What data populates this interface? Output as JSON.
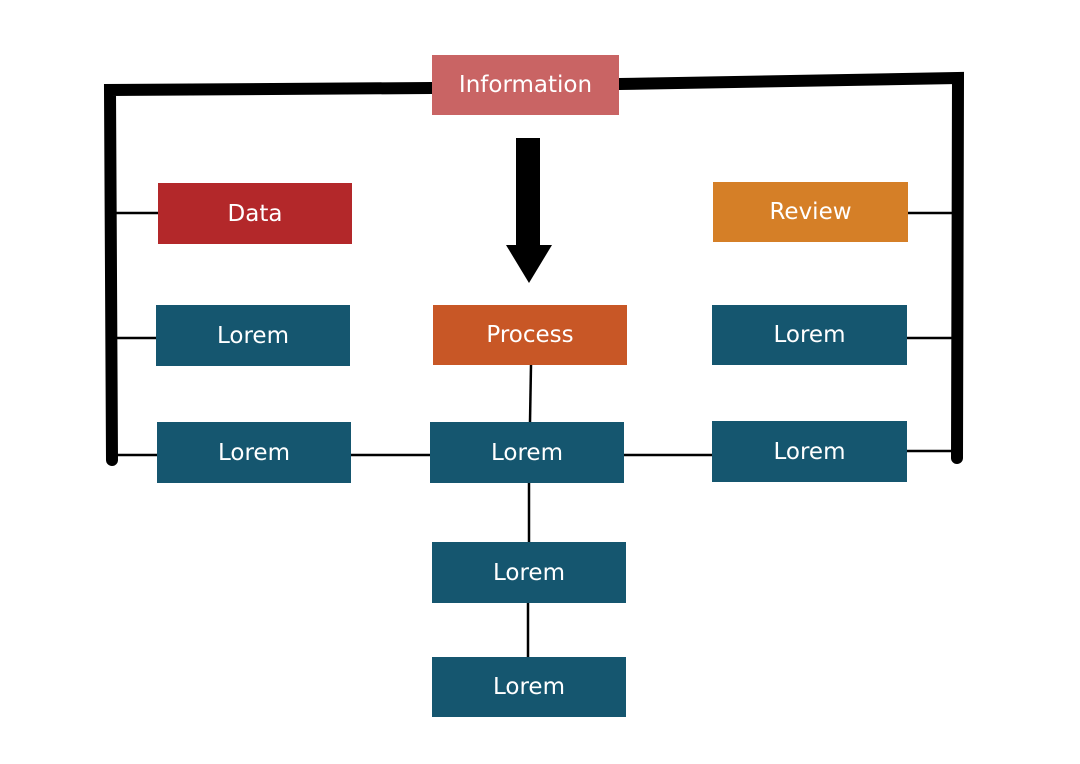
{
  "nodes": {
    "information": {
      "label": "Information",
      "color": "#c96464"
    },
    "data": {
      "label": "Data",
      "color": "#b3282a"
    },
    "review": {
      "label": "Review",
      "color": "#d57f27"
    },
    "process": {
      "label": "Process",
      "color": "#c85726"
    },
    "left_1": {
      "label": "Lorem",
      "color": "#15566f"
    },
    "left_2": {
      "label": "Lorem",
      "color": "#15566f"
    },
    "right_1": {
      "label": "Lorem",
      "color": "#15566f"
    },
    "right_2": {
      "label": "Lorem",
      "color": "#15566f"
    },
    "center_1": {
      "label": "Lorem",
      "color": "#15566f"
    },
    "center_2": {
      "label": "Lorem",
      "color": "#15566f"
    },
    "center_3": {
      "label": "Lorem",
      "color": "#15566f"
    }
  }
}
